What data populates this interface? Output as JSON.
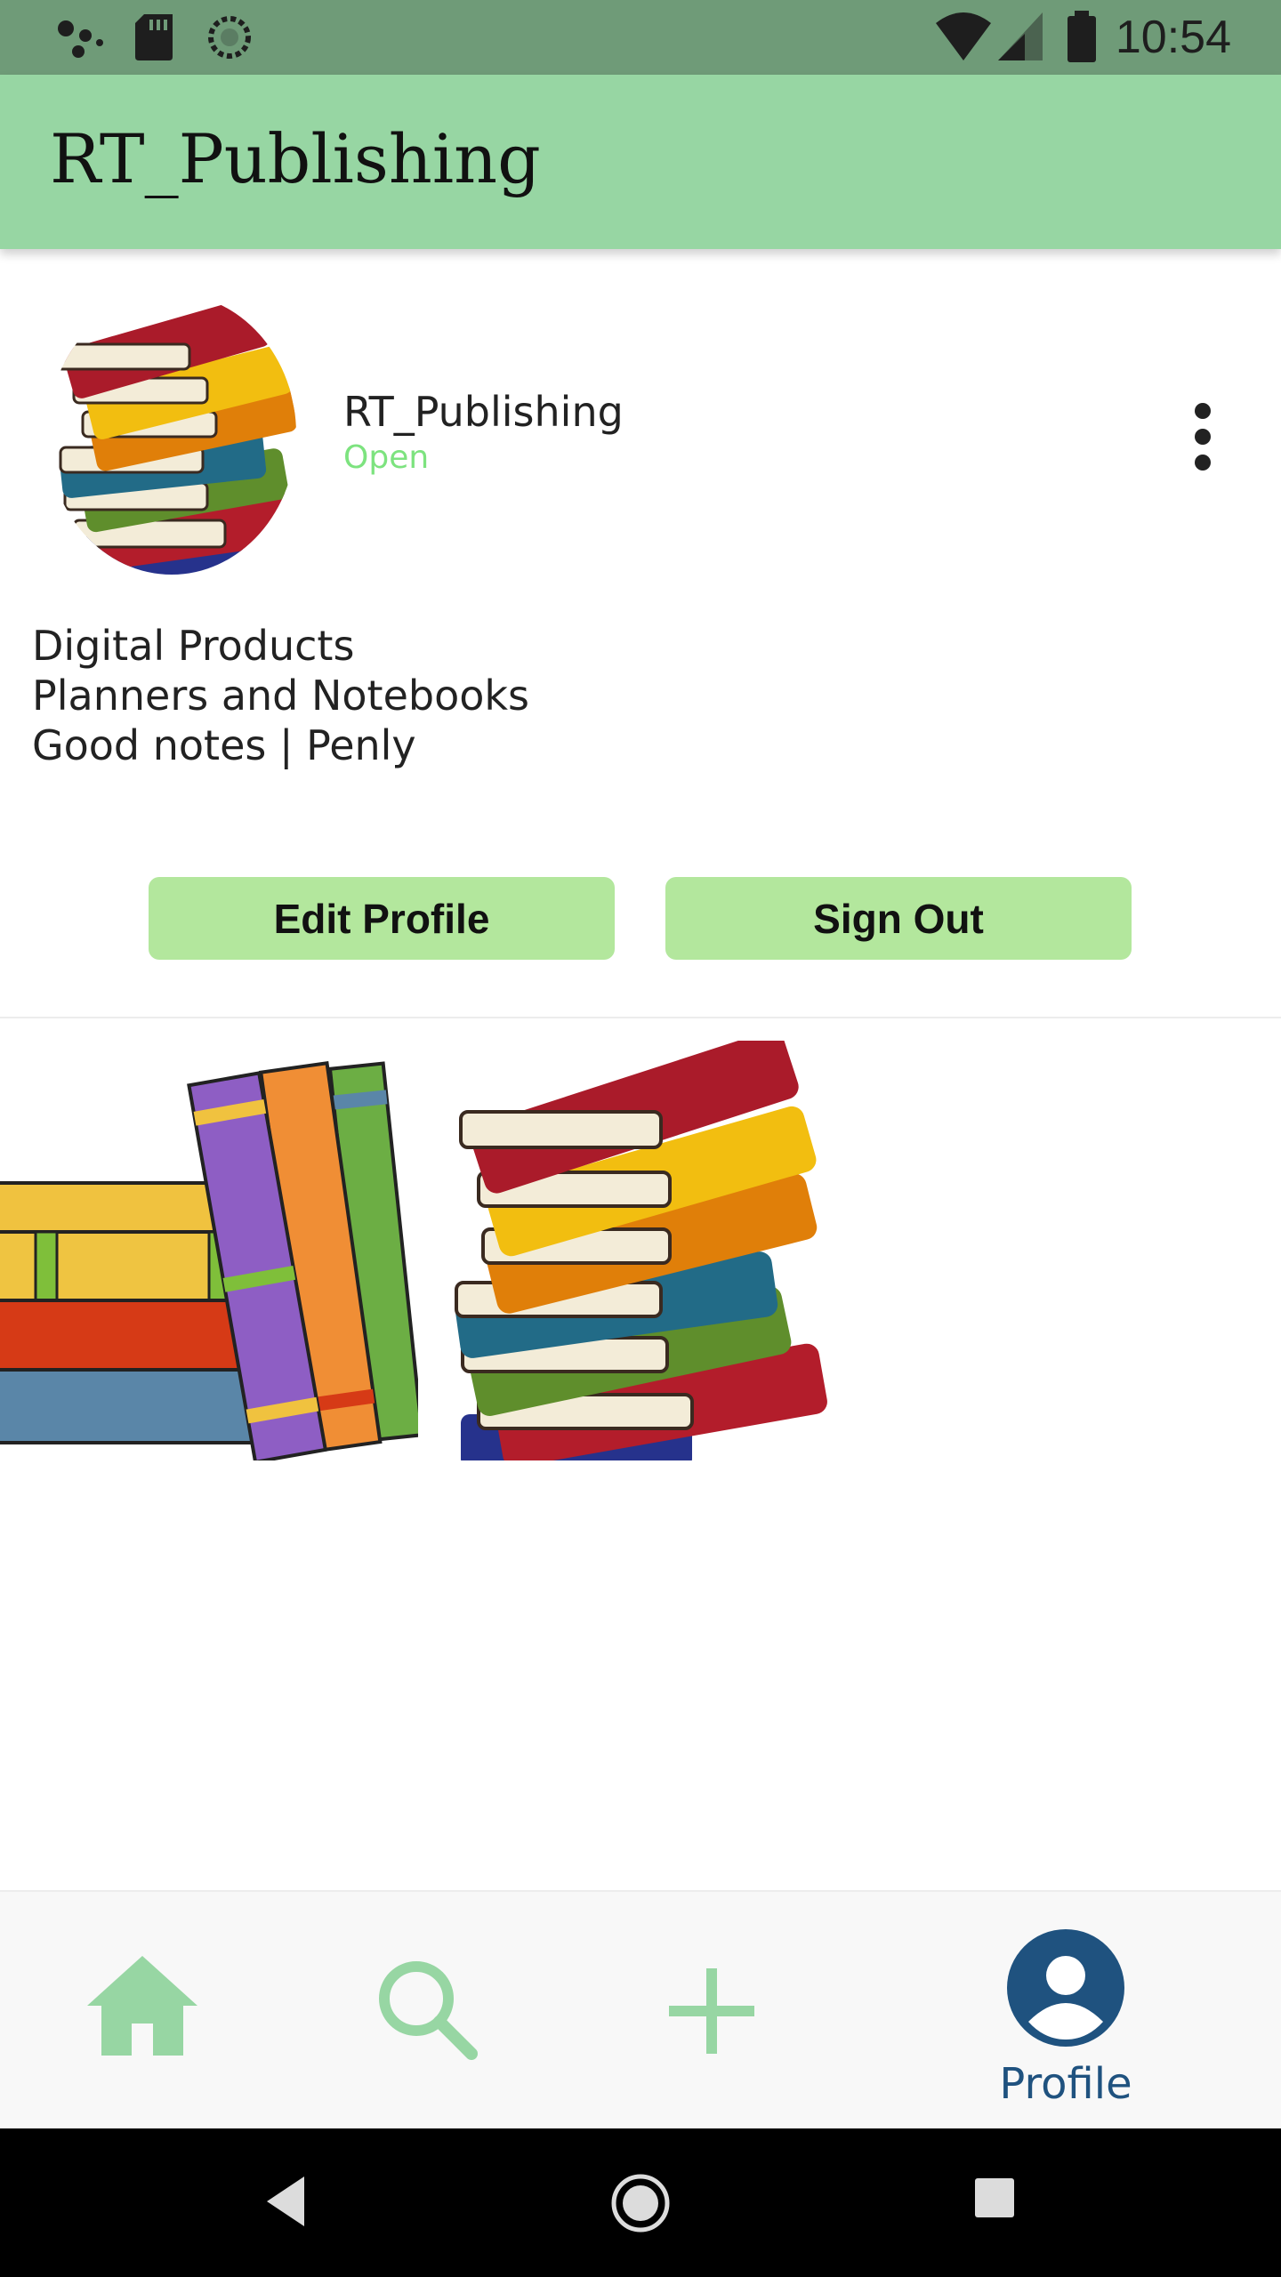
{
  "status_bar": {
    "time": "10:54",
    "icons": [
      "assistant-icon",
      "sd-card-icon",
      "sync-icon",
      "wifi-icon",
      "signal-icon",
      "battery-icon"
    ]
  },
  "app_bar": {
    "title": "RT_Publishing"
  },
  "profile": {
    "username": "RT_Publishing",
    "status": "Open",
    "bio_lines": [
      "Digital Products",
      "Planners and Notebooks",
      "Good notes | Penly"
    ]
  },
  "actions": {
    "edit_label": "Edit Profile",
    "signout_label": "Sign Out"
  },
  "posts": [
    "standing-books-post",
    "book-stack-post"
  ],
  "bottom_nav": {
    "items": [
      {
        "icon": "home-icon",
        "label": ""
      },
      {
        "icon": "search-icon",
        "label": ""
      },
      {
        "icon": "add-icon",
        "label": ""
      },
      {
        "icon": "profile-icon",
        "label": "Profile"
      }
    ],
    "active_index": 3
  },
  "colors": {
    "status_bar": "#6f9b78",
    "app_bar": "#97d6a3",
    "button": "#b3e79d",
    "status_open": "#7de37f",
    "nav_inactive": "#97d6a3",
    "nav_active": "#1f527f"
  }
}
